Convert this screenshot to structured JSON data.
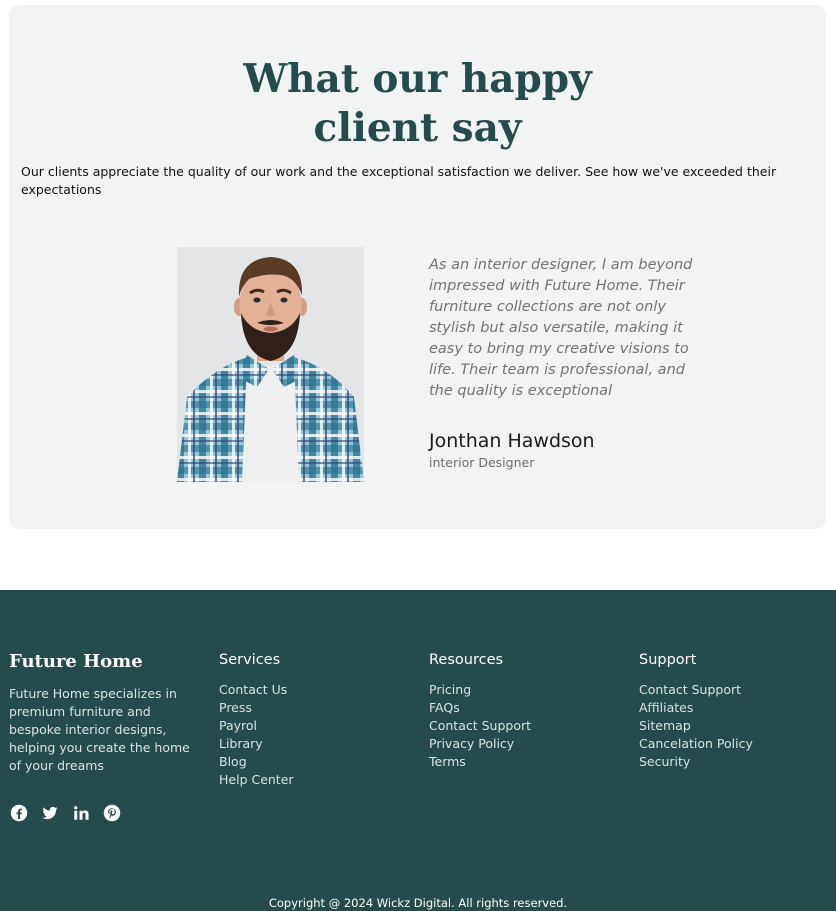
{
  "testimonial": {
    "title_line1": "What our happy",
    "title_line2": "client say",
    "subtitle": "Our clients appreciate the quality of our work and the exceptional satisfaction we deliver. See how we've exceeded their expectations",
    "quote": "As an interior designer, I am beyond impressed with Future Home. Their furniture collections are not only stylish but also versatile, making it easy to bring my creative visions to life. Their team is professional, and the quality is exceptional",
    "author_name": "Jonthan Hawdson",
    "author_role": "interior Designer"
  },
  "footer": {
    "brand": {
      "title": "Future Home",
      "description": "Future Home specializes in premium furniture and bespoke interior designs, helping you create the home of your dreams"
    },
    "social_icons": [
      "facebook-icon",
      "twitter-icon",
      "linkedin-icon",
      "pinterest-icon"
    ],
    "columns": [
      {
        "heading": "Services",
        "links": [
          "Contact Us",
          "Press",
          "Payrol",
          "Library",
          "Blog",
          "Help Center"
        ]
      },
      {
        "heading": "Resources",
        "links": [
          "Pricing",
          "FAQs",
          "Contact Support",
          "Privacy Policy",
          "Terms"
        ]
      },
      {
        "heading": "Support",
        "links": [
          "Contact Support",
          "Affiliates",
          "Sitemap",
          "Cancelation Policy",
          "Security"
        ]
      }
    ],
    "copyright": "Copyright @ 2024 Wickz Digital. All rights reserved."
  },
  "colors": {
    "accent": "#244c4c",
    "section_bg": "#f2f4f3",
    "quote_text": "#737373"
  }
}
